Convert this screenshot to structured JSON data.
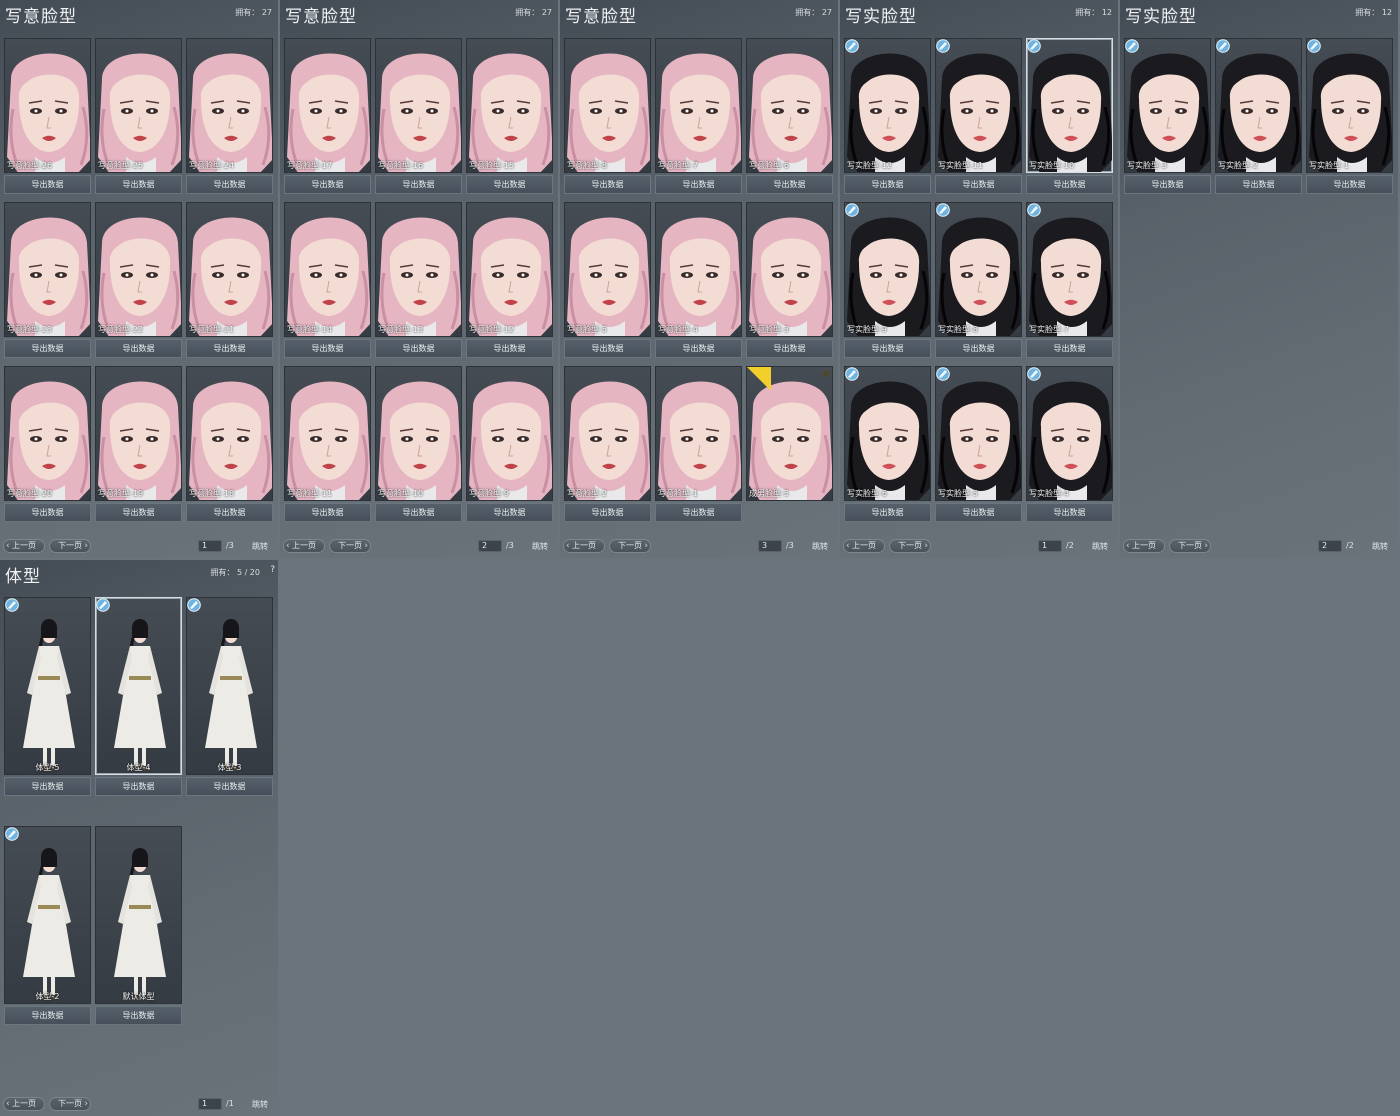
{
  "common": {
    "owned_prefix": "拥有：",
    "export_label": "导出数据",
    "prev_label": "上一页",
    "next_label": "下一页",
    "jump_label": "跳转",
    "help_label": "?",
    "new_tag": "新"
  },
  "colors": {
    "hair_pink": "#e6b5c2",
    "hair_black": "#1a1a1f",
    "skin": "#f3dcd3",
    "badge_blue": "#6fb4e0",
    "tag_yellow": "#f2cf2a"
  },
  "panels": [
    {
      "title": "写意脸型",
      "owned": "27",
      "page": "1",
      "total": "/3",
      "style": "pink",
      "items": [
        {
          "name": "写意脸型-26",
          "badge": false
        },
        {
          "name": "写意脸型-25",
          "badge": false
        },
        {
          "name": "写意脸型-24",
          "badge": false
        },
        {
          "name": "写意脸型-23",
          "badge": false
        },
        {
          "name": "写意脸型-22",
          "badge": false
        },
        {
          "name": "写意脸型-21",
          "badge": false
        },
        {
          "name": "写意脸型-20",
          "badge": false
        },
        {
          "name": "写意脸型-19",
          "badge": false
        },
        {
          "name": "写意脸型-18",
          "badge": false
        }
      ]
    },
    {
      "title": "写意脸型",
      "owned": "27",
      "page": "2",
      "total": "/3",
      "style": "pink",
      "items": [
        {
          "name": "写意脸型-17",
          "badge": false
        },
        {
          "name": "写意脸型-16",
          "badge": false
        },
        {
          "name": "写意脸型-15",
          "badge": false
        },
        {
          "name": "写意脸型-14",
          "badge": false
        },
        {
          "name": "写意脸型-13",
          "badge": false
        },
        {
          "name": "写意脸型-12",
          "badge": false
        },
        {
          "name": "写意脸型-11",
          "badge": false
        },
        {
          "name": "写意脸型-10",
          "badge": false
        },
        {
          "name": "写意脸型-9",
          "badge": false
        }
      ]
    },
    {
      "title": "写意脸型",
      "owned": "27",
      "page": "3",
      "total": "/3",
      "style": "pink",
      "items": [
        {
          "name": "写意脸型-8",
          "badge": false
        },
        {
          "name": "写意脸型-7",
          "badge": false
        },
        {
          "name": "写意脸型-6",
          "badge": false
        },
        {
          "name": "写意脸型-5",
          "badge": false
        },
        {
          "name": "写意脸型-4",
          "badge": false
        },
        {
          "name": "写意脸型-3",
          "badge": false
        },
        {
          "name": "写意脸型-2",
          "badge": false
        },
        {
          "name": "写意脸型-1",
          "badge": false
        },
        {
          "name": "成男脸型-5",
          "badge": false,
          "no_export": true,
          "new": true
        }
      ]
    },
    {
      "title": "写实脸型",
      "owned": "12",
      "page": "1",
      "total": "/2",
      "style": "black",
      "items": [
        {
          "name": "写实脸型-12",
          "badge": true
        },
        {
          "name": "写实脸型-11",
          "badge": true
        },
        {
          "name": "写实脸型-10",
          "badge": true,
          "selected": true
        },
        {
          "name": "写实脸型-9",
          "badge": true
        },
        {
          "name": "写实脸型-8",
          "badge": true
        },
        {
          "name": "写实脸型-7",
          "badge": true
        },
        {
          "name": "写实脸型-6",
          "badge": true
        },
        {
          "name": "写实脸型-5",
          "badge": true
        },
        {
          "name": "写实脸型-4",
          "badge": true
        }
      ]
    },
    {
      "title": "写实脸型",
      "owned": "12",
      "page": "2",
      "total": "/2",
      "style": "black",
      "items": [
        {
          "name": "写实脸型-3",
          "badge": true
        },
        {
          "name": "写实脸型-2",
          "badge": true
        },
        {
          "name": "写实脸型-1",
          "badge": true
        }
      ]
    }
  ],
  "body_panel": {
    "title": "体型",
    "owned": "5 / 20",
    "page": "1",
    "total": "/1",
    "items": [
      {
        "name": "体型-5",
        "badge": true
      },
      {
        "name": "体型-4",
        "badge": true,
        "selected": true
      },
      {
        "name": "体型-3",
        "badge": true
      },
      {
        "name": "体型-2",
        "badge": true
      },
      {
        "name": "默认体型",
        "badge": false
      }
    ]
  }
}
